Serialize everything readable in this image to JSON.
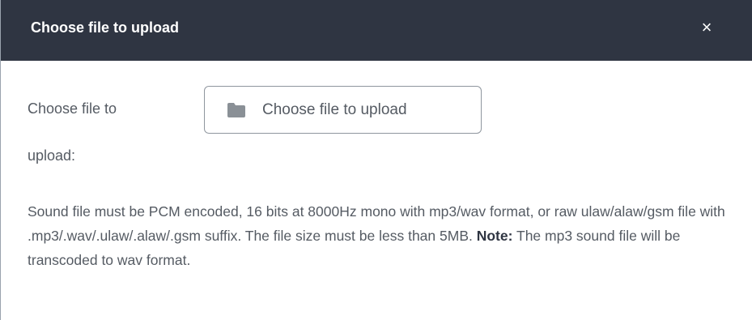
{
  "dialog": {
    "title": "Choose file to upload",
    "close_label": "×"
  },
  "field": {
    "label_line1": "Choose file to",
    "label_line2": "upload:",
    "button_label": "Choose file to upload",
    "button_icon": "folder-icon"
  },
  "description": {
    "text_before_note": "Sound file must be PCM encoded, 16 bits at 8000Hz mono with mp3/wav format, or raw ulaw/alaw/gsm file with .mp3/.wav/.ulaw/.alaw/.gsm suffix. The file size must be less than 5MB. ",
    "note_label": "Note:",
    "text_after_note": " The mp3 sound file will be transcoded to wav format."
  },
  "colors": {
    "titlebar": "#2f3542",
    "text": "#555b63",
    "border": "#8f969e"
  }
}
